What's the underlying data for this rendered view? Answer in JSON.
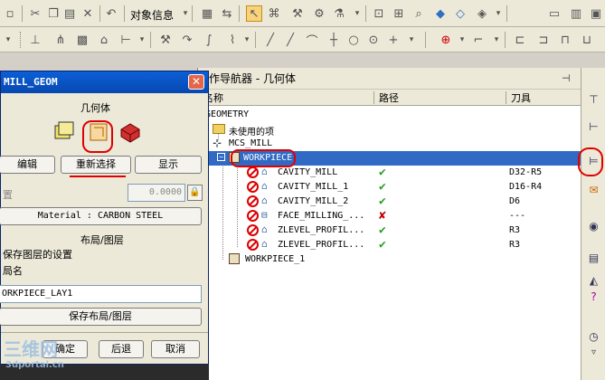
{
  "toolbar1": {
    "object_info_label": "对象信息"
  },
  "navigator": {
    "title": "作导航器 - 几何体",
    "columns": {
      "name": "名称",
      "path": "路径",
      "tool": "刀具"
    },
    "rows": [
      {
        "name": "GEOMETRY",
        "path": "",
        "tool": ""
      },
      {
        "name": "未使用的项",
        "path": "",
        "tool": ""
      },
      {
        "name": "MCS_MILL",
        "path": "",
        "tool": ""
      },
      {
        "name": "WORKPIECE",
        "path": "",
        "tool": ""
      },
      {
        "name": "CAVITY_MILL",
        "path": "✔",
        "tool": "D32-R5"
      },
      {
        "name": "CAVITY_MILL_1",
        "path": "✔",
        "tool": "D16-R4"
      },
      {
        "name": "CAVITY_MILL_2",
        "path": "✔",
        "tool": "D6"
      },
      {
        "name": "FACE_MILLING_...",
        "path": "✘",
        "tool": "---"
      },
      {
        "name": "ZLEVEL_PROFIL...",
        "path": "✔",
        "tool": "R3"
      },
      {
        "name": "ZLEVEL_PROFIL...",
        "path": "✔",
        "tool": "R3"
      },
      {
        "name": "WORKPIECE_1",
        "path": "",
        "tool": ""
      }
    ]
  },
  "dialog": {
    "title": "MILL_GEOM",
    "section_geometry": "几何体",
    "btn_edit": "编辑",
    "btn_reselect": "重新选择",
    "btn_display": "显示",
    "offset_label": "置",
    "offset_value": "0.0000",
    "material_button": "Material : CARBON STEEL",
    "section_layout": "布局/图层",
    "save_layer_settings": "保存图层的设置",
    "layout_name_label": "局名",
    "layout_name_value": "ORKPIECE_LAY1",
    "btn_save_layout": "保存布局/图层",
    "btn_ok": "确定",
    "btn_back": "后退",
    "btn_cancel": "取消"
  },
  "watermark": {
    "main": "三维网",
    "sub": "3dportal.cn"
  },
  "colors": {
    "selection": "#316ac5",
    "ok": "#2ca02c",
    "error": "#c00000",
    "annotation": "#e00000"
  }
}
